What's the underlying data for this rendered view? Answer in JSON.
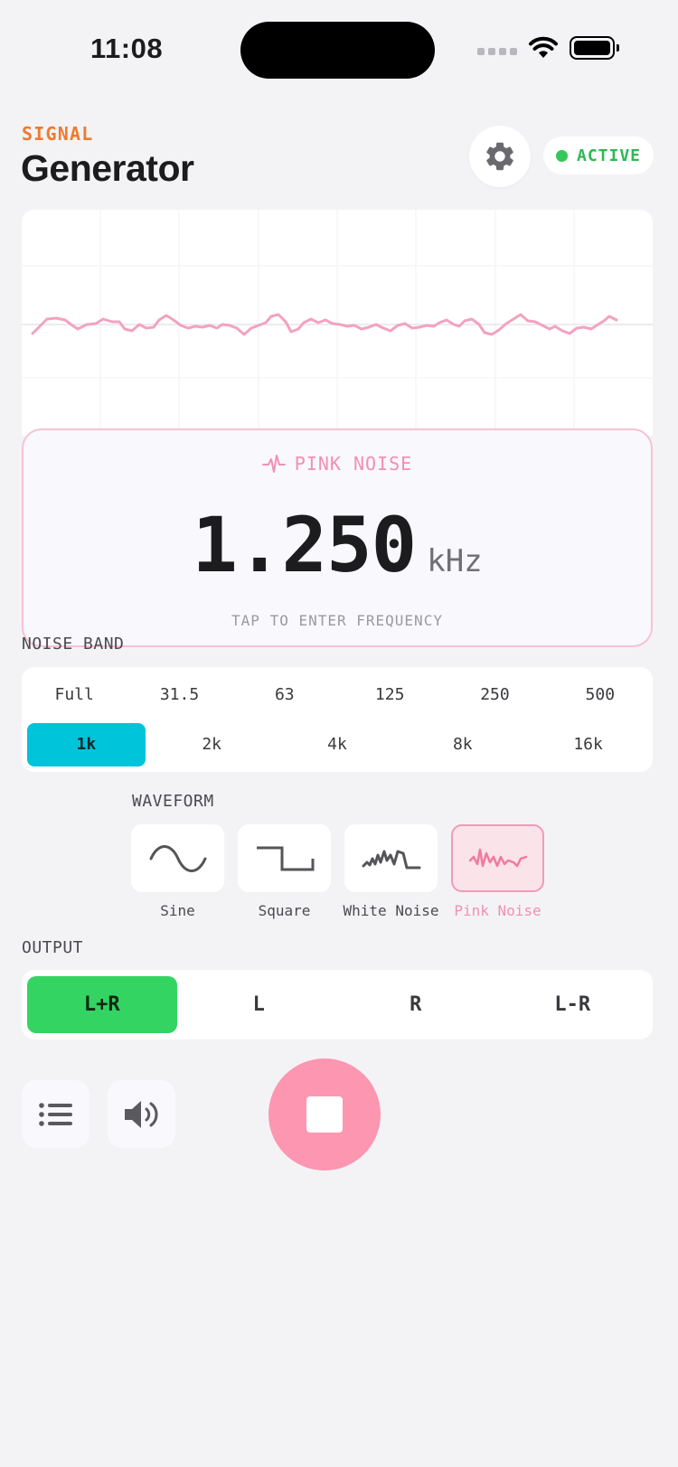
{
  "status_bar": {
    "time": "11:08"
  },
  "header": {
    "eyebrow": "SIGNAL",
    "title": "Generator",
    "status": "ACTIVE"
  },
  "display": {
    "waveform_label": "PINK NOISE",
    "frequency": "1.250",
    "unit": "kHz",
    "hint": "TAP TO ENTER FREQUENCY"
  },
  "noise_band": {
    "label": "NOISE BAND",
    "row1": [
      "Full",
      "31.5",
      "63",
      "125",
      "250",
      "500"
    ],
    "row2": [
      "1k",
      "2k",
      "4k",
      "8k",
      "16k"
    ],
    "selected": "1k"
  },
  "waveform": {
    "label": "WAVEFORM",
    "options": [
      "Sine",
      "Square",
      "White Noise",
      "Pink Noise"
    ],
    "selected": "Pink Noise",
    "icons": [
      "sine-wave-icon",
      "square-wave-icon",
      "white-noise-icon",
      "pink-noise-icon"
    ]
  },
  "output": {
    "label": "OUTPUT",
    "options": [
      "L+R",
      "L",
      "R",
      "L-R"
    ],
    "selected": "L+R"
  },
  "controls": {
    "left_icons": [
      "list-icon",
      "speaker-icon"
    ],
    "main_icon": "stop-icon"
  },
  "colors": {
    "accent_orange": "#ee7b30",
    "pink": "#f38fb0",
    "cyan": "#00c4da",
    "green": "#34d463",
    "stop": "#fd96b0"
  }
}
